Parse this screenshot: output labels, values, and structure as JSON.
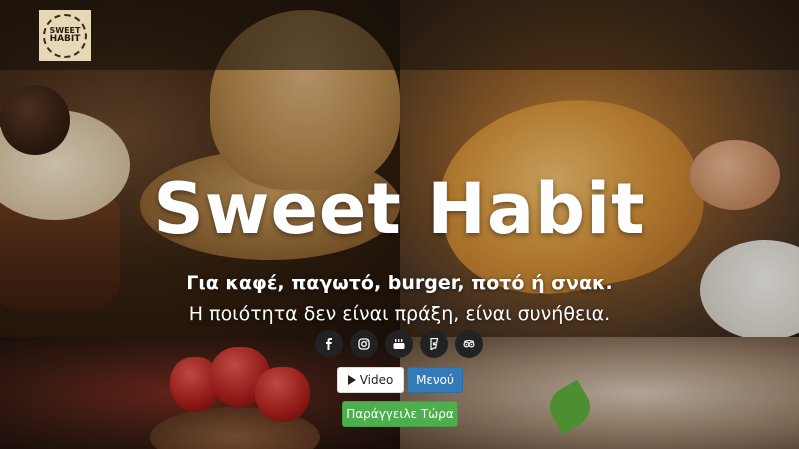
{
  "brand": {
    "logo_line1": "SWEET",
    "logo_line2": "HABIT"
  },
  "hero": {
    "title": "Sweet Habit",
    "tagline": "Για καφέ, παγωτό, burger, ποτό ή σνακ.",
    "subtitle": "Η ποιότητα δεν είναι πράξη, είναι συνήθεια."
  },
  "social": [
    {
      "name": "facebook-icon",
      "glyph": "f"
    },
    {
      "name": "instagram-icon",
      "glyph": "instagram"
    },
    {
      "name": "youtube-icon",
      "glyph": "youtube"
    },
    {
      "name": "foursquare-icon",
      "glyph": "foursquare"
    },
    {
      "name": "tripadvisor-icon",
      "glyph": "tripadvisor"
    }
  ],
  "buttons": {
    "video_label": "Video",
    "menu_label": "Μενού",
    "order_label": "Παράγγειλε Τώρα"
  },
  "colors": {
    "menu_button": "#337ab7",
    "order_button": "#4cae4c",
    "social_bg": "#222222"
  }
}
